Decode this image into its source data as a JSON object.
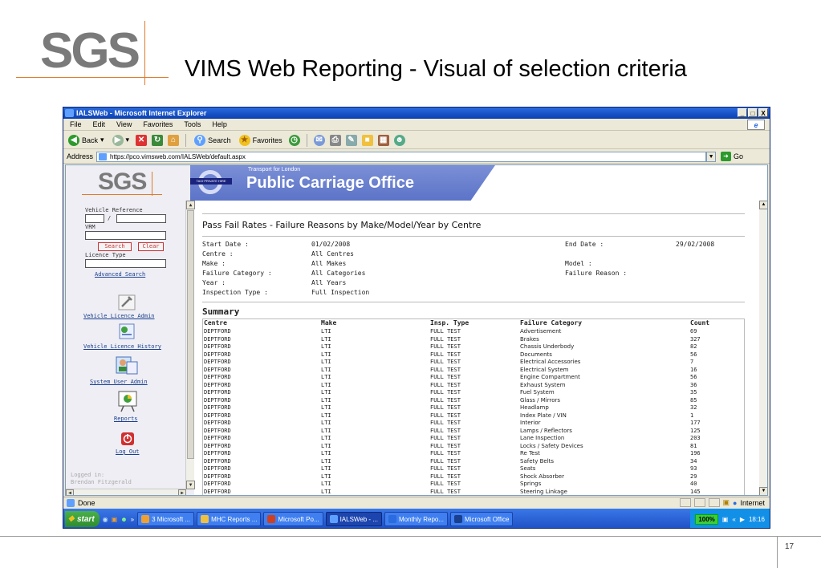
{
  "slide": {
    "logo_text": "SGS",
    "title": "VIMS Web Reporting - Visual of selection criteria",
    "page_number": "17"
  },
  "browser": {
    "title": "IALSWeb - Microsoft Internet Explorer",
    "window_controls": [
      "_",
      "□",
      "X"
    ],
    "menu": [
      "File",
      "Edit",
      "View",
      "Favorites",
      "Tools",
      "Help"
    ],
    "toolbar": {
      "back_label": "Back",
      "search_label": "Search",
      "favorites_label": "Favorites"
    },
    "address_label": "Address",
    "address_url": "https://pco.vimsweb.com/IALSWeb/default.aspx",
    "go_label": "Go",
    "status_text": "Done",
    "status_zone": "Internet"
  },
  "left_nav": {
    "logo_text": "SGS",
    "vehicle_reference_label": "Vehicle Reference",
    "slash": "/",
    "vrm_label": "VRM",
    "search_button": "Search",
    "clear_button": "Clear",
    "licence_type_label": "Licence Type",
    "advanced_search_link": "Advanced Search",
    "links": [
      {
        "label": "Vehicle Licence Admin",
        "icon": "wrench-icon"
      },
      {
        "label": "Vehicle Licence History",
        "icon": "certificate-icon"
      },
      {
        "label": "System User Admin",
        "icon": "users-icon"
      },
      {
        "label": "Reports",
        "icon": "chart-board-icon"
      },
      {
        "label": "Log Out",
        "icon": "power-icon"
      }
    ],
    "logged_in_label": "Logged in:",
    "logged_in_user": "Brendan Fitzgerald"
  },
  "banner": {
    "small_text": "Transport for London",
    "big_text": "Public Carriage Office",
    "roundel_text": "TAXI·PRIVATE HIRE"
  },
  "report": {
    "title": "Pass Fail Rates - Failure Reasons by Make/Model/Year by Centre",
    "criteria": {
      "start_date_label": "Start Date :",
      "start_date": "01/02/2008",
      "end_date_label": "End Date :",
      "end_date": "29/02/2008",
      "centre_label": "Centre :",
      "centre": "All Centres",
      "make_label": "Make :",
      "make": "All Makes",
      "model_label": "Model :",
      "model": "",
      "failure_category_label": "Failure Category :",
      "failure_category": "All Categories",
      "failure_reason_label": "Failure Reason :",
      "failure_reason": "",
      "year_label": "Year :",
      "year": "All Years",
      "inspection_type_label": "Inspection Type :",
      "inspection_type": "Full Inspection"
    },
    "summary_title": "Summary",
    "columns": [
      "Centre",
      "Make",
      "Insp. Type",
      "Failure Category",
      "Count"
    ],
    "rows": [
      [
        "DEPTFORD",
        "LTI",
        "FULL TEST",
        "Advertisement",
        "69"
      ],
      [
        "DEPTFORD",
        "LTI",
        "FULL TEST",
        "Brakes",
        "327"
      ],
      [
        "DEPTFORD",
        "LTI",
        "FULL TEST",
        "Chassis Underbody",
        "82"
      ],
      [
        "DEPTFORD",
        "LTI",
        "FULL TEST",
        "Documents",
        "56"
      ],
      [
        "DEPTFORD",
        "LTI",
        "FULL TEST",
        "Electrical Accessories",
        "7"
      ],
      [
        "DEPTFORD",
        "LTI",
        "FULL TEST",
        "Electrical System",
        "16"
      ],
      [
        "DEPTFORD",
        "LTI",
        "FULL TEST",
        "Engine Compartment",
        "56"
      ],
      [
        "DEPTFORD",
        "LTI",
        "FULL TEST",
        "Exhaust System",
        "36"
      ],
      [
        "DEPTFORD",
        "LTI",
        "FULL TEST",
        "Fuel System",
        "35"
      ],
      [
        "DEPTFORD",
        "LTI",
        "FULL TEST",
        "Glass / Mirrors",
        "85"
      ],
      [
        "DEPTFORD",
        "LTI",
        "FULL TEST",
        "Headlamp",
        "32"
      ],
      [
        "DEPTFORD",
        "LTI",
        "FULL TEST",
        "Index Plate / VIN",
        "1"
      ],
      [
        "DEPTFORD",
        "LTI",
        "FULL TEST",
        "Interior",
        "177"
      ],
      [
        "DEPTFORD",
        "LTI",
        "FULL TEST",
        "Lamps / Reflectors",
        "125"
      ],
      [
        "DEPTFORD",
        "LTI",
        "FULL TEST",
        "Lane Inspection",
        "203"
      ],
      [
        "DEPTFORD",
        "LTI",
        "FULL TEST",
        "Locks / Safety Devices",
        "81"
      ],
      [
        "DEPTFORD",
        "LTI",
        "FULL TEST",
        "Re Test",
        "196"
      ],
      [
        "DEPTFORD",
        "LTI",
        "FULL TEST",
        "Safety Belts",
        "34"
      ],
      [
        "DEPTFORD",
        "LTI",
        "FULL TEST",
        "Seats",
        "93"
      ],
      [
        "DEPTFORD",
        "LTI",
        "FULL TEST",
        "Shock Absorber",
        "29"
      ],
      [
        "DEPTFORD",
        "LTI",
        "FULL TEST",
        "Springs",
        "40"
      ],
      [
        "DEPTFORD",
        "LTI",
        "FULL TEST",
        "Steering Linkage",
        "145"
      ]
    ]
  },
  "taskbar": {
    "start_label": "start",
    "items": [
      {
        "label": "3 Microsoft ...",
        "active": false,
        "color": "#f0a030"
      },
      {
        "label": "MHC Reports ...",
        "active": false,
        "color": "#f0c040"
      },
      {
        "label": "Microsoft Po...",
        "active": false,
        "color": "#d04020"
      },
      {
        "label": "IALSWeb - ...",
        "active": true,
        "color": "#5fa0ff"
      },
      {
        "label": "Monthly Repo...",
        "active": false,
        "color": "#2a6be0"
      },
      {
        "label": "Microsoft Office",
        "active": false,
        "color": "#1a3f8f"
      }
    ],
    "zoom": "100%",
    "clock": "18:16"
  },
  "colors": {
    "accent_orange": "#e07b2a",
    "banner_blue": "#5c74c8",
    "xp_blue": "#2a6be0"
  }
}
